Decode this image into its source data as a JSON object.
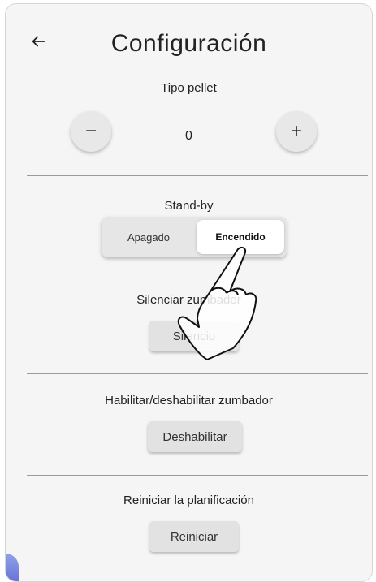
{
  "header": {
    "title": "Configuración",
    "back_icon": "arrow-left-icon"
  },
  "pellet": {
    "label": "Tipo pellet",
    "value": "0",
    "minus": "−",
    "plus": "+"
  },
  "standby": {
    "label": "Stand-by",
    "options": [
      "Apagado",
      "Encendido"
    ],
    "selected": "Encendido"
  },
  "silence": {
    "label": "Silenciar zumbador",
    "button": "Silencio"
  },
  "buzzer": {
    "label": "Habilitar/deshabilitar zumbador",
    "button": "Deshabilitar"
  },
  "reset": {
    "label": "Reiniciar la planificación",
    "button": "Reiniciar"
  }
}
